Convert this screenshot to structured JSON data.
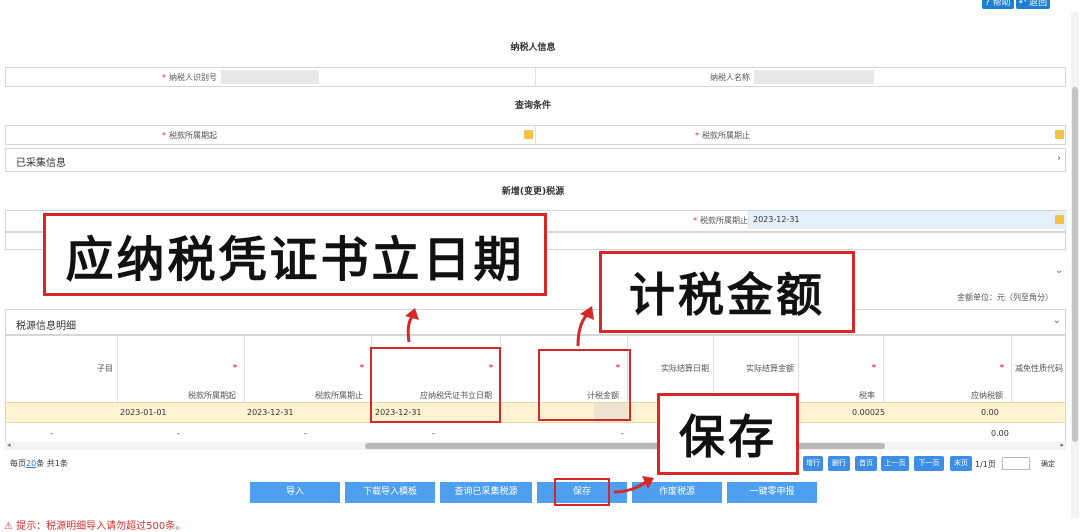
{
  "top": {
    "help": "帮助",
    "back": "返回"
  },
  "sections": {
    "taxpayer_info": "纳税人信息",
    "query_conditions": "查询条件",
    "collected": "已采集信息",
    "new_source": "新增(变更)税源",
    "detail": "税源信息明细"
  },
  "taxpayer": {
    "id_label": "纳税人识别号",
    "name_label": "纳税人名称"
  },
  "query": {
    "period_start_label": "税款所属期起",
    "period_end_label": "税款所属期止"
  },
  "new_source_form": {
    "period_end_label": "税款所属期止",
    "period_end_value": "2023-12-31"
  },
  "unit_note": "金额单位：元（列至角分）",
  "table": {
    "columns": [
      "子目",
      "税款所属期起",
      "税款所属期止",
      "应纳税凭证书立日期",
      "计税金额",
      "实际结算日期",
      "实际结算金额",
      "税率",
      "应纳税额",
      "减免性质代码"
    ],
    "required": [
      false,
      true,
      true,
      true,
      true,
      false,
      false,
      true,
      true,
      false
    ],
    "row1": {
      "period_start": "2023-01-01",
      "period_end": "2023-12-31",
      "doc_date": "2023-12-31",
      "rate": "0.00025",
      "tax": "0.00"
    },
    "row2": {
      "c1": "-",
      "c2": "-",
      "c3": "-",
      "c4": "-",
      "c5": "-",
      "tax": "0.00"
    }
  },
  "pager": {
    "per_page_prefix": "每页",
    "per_page": "20",
    "per_page_suffix": "条 共1条",
    "btn_add": "增行",
    "btn_del": "删行",
    "btn_first": "首页",
    "btn_prev": "上一页",
    "btn_next": "下一页",
    "btn_last": "末页",
    "page_info": "1/1页",
    "confirm": "确定"
  },
  "actions": {
    "import": "导入",
    "download_template": "下载导入模板",
    "query_collected": "查询已采集税源",
    "save": "保存",
    "void": "作废税源",
    "zero_declare": "一键零申报"
  },
  "tip": "提示：税源明细导入请勿超过500条。",
  "callouts": {
    "doc_date": "应纳税凭证书立日期",
    "tax_amount": "计税金额",
    "save": "保存"
  },
  "colors": {
    "accent": "#4f9ff0",
    "highlight": "#d62828",
    "selected_row": "#fdf3d2",
    "calendar": "#f2c24a"
  }
}
